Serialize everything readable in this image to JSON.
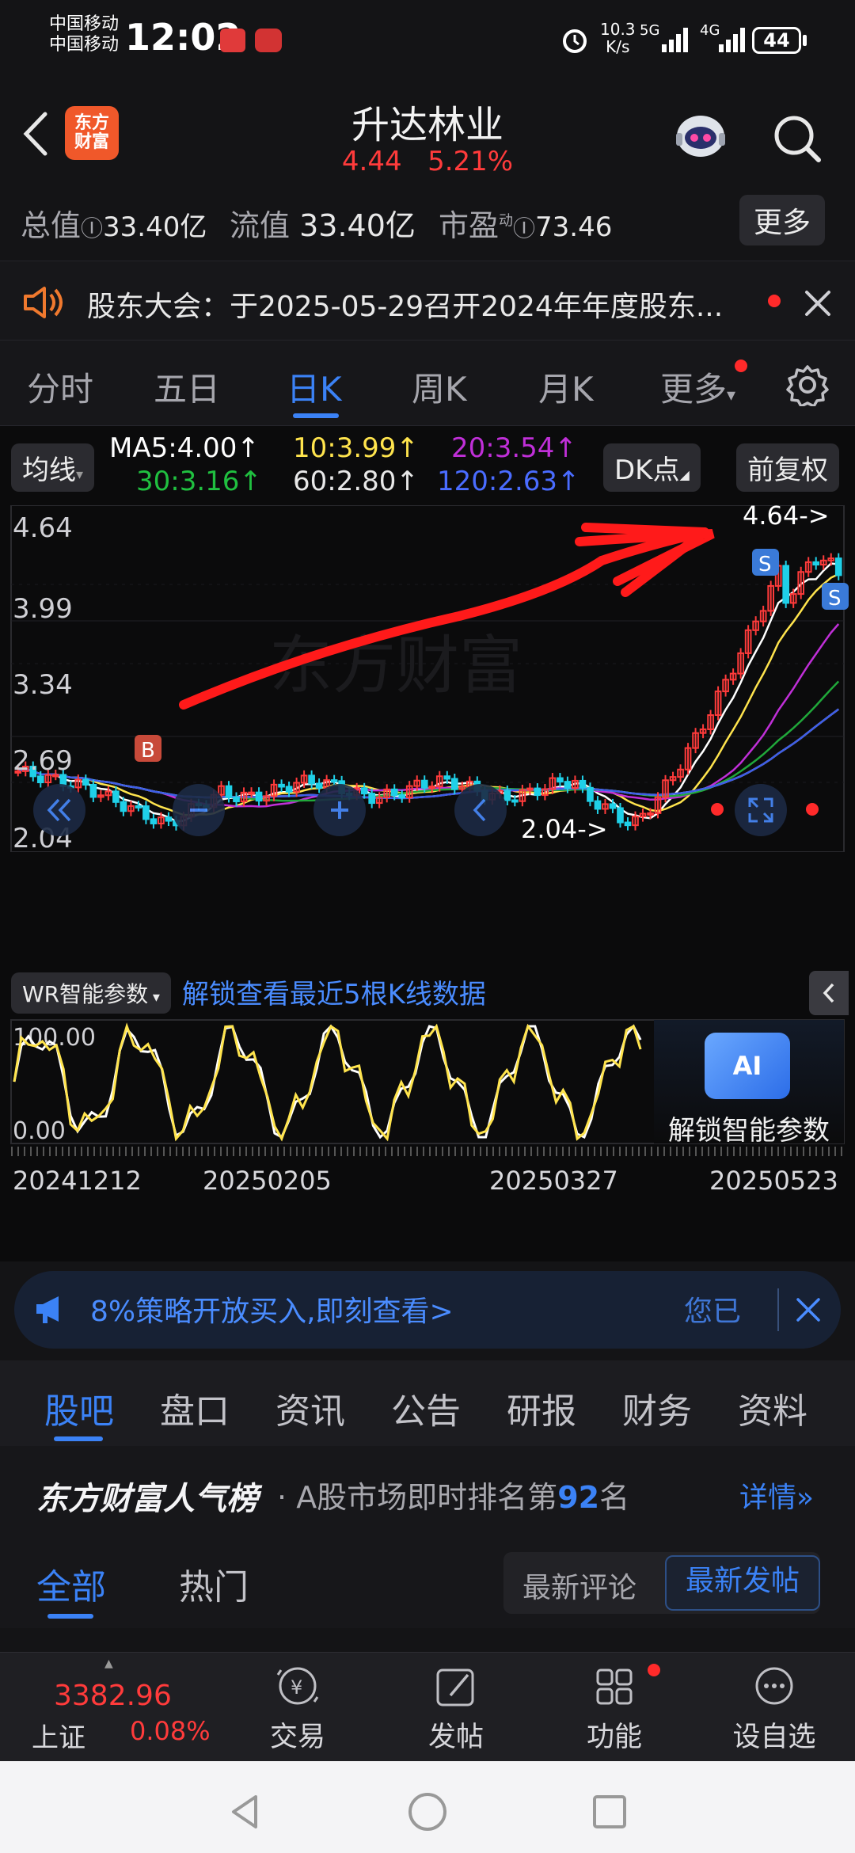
{
  "status": {
    "carrier1": "中国移动",
    "carrier2": "中国移动",
    "time": "12:02",
    "network_speed_value": "10.3",
    "network_speed_unit": "K/s",
    "signal1": "5G",
    "signal2": "4G",
    "battery": "44"
  },
  "header": {
    "title": "升达林业",
    "price": "4.44",
    "change_pct": "5.21%",
    "logo_text_top": "东方",
    "logo_text_bottom": "财富"
  },
  "metrics": {
    "total_value_label": "总值",
    "total_value": "33.40亿",
    "float_value_label": "流值",
    "float_value": "33.40亿",
    "pe_label": "市盈",
    "pe_sup": "动",
    "pe_value": "73.46",
    "more_label": "更多"
  },
  "notice": {
    "text": "股东大会：于2025-05-29召开2024年年度股东..."
  },
  "period_tabs": [
    "分时",
    "五日",
    "日K",
    "周K",
    "月K",
    "更多"
  ],
  "chart_controls": {
    "ma_button": "均线",
    "ma5": "MA5:4.00↑",
    "ma10": "10:3.99↑",
    "ma20": "20:3.54↑",
    "ma30": "30:3.16↑",
    "ma60": "60:2.80↑",
    "ma120": "120:2.63↑",
    "dk_button": "DK点",
    "adjust_button": "前复权"
  },
  "chart_labels": {
    "y_axis": [
      "4.64",
      "3.99",
      "3.34",
      "2.69",
      "2.04"
    ],
    "high_marker": "4.64->",
    "low_marker": "2.04->",
    "buy_marker": "B",
    "sell_marker": "S",
    "watermark": "东方财富"
  },
  "indicator": {
    "name_button": "WR智能参数",
    "unlock_text": "解锁查看最近5根K线数据",
    "y_top": "100.00",
    "y_bottom": "0.00",
    "ai_badge": "AI",
    "ai_unlock": "解锁智能参数"
  },
  "x_axis": [
    "20241212",
    "20250205",
    "20250327",
    "20250523"
  ],
  "colors": {
    "up": "#ff3b3b",
    "down": "#1fd0e8",
    "ma5": "#ffffff",
    "ma10": "#ffe44d",
    "ma20": "#c02fd8",
    "ma30": "#20a83a",
    "ma60": "#e8e8e8",
    "ma120": "#3d5de8",
    "accent": "#3b82f6",
    "red_price": "#ff3b3b"
  },
  "promo": {
    "text": "8%策略开放买入,即刻查看>",
    "tail": "您已"
  },
  "content_tabs": [
    "股吧",
    "盘口",
    "资讯",
    "公告",
    "研报",
    "财务",
    "资料"
  ],
  "rank": {
    "brand": "东方财富人气榜",
    "separator": "·",
    "prefix": "A股市场即时排名第",
    "number": "92",
    "suffix": "名",
    "link": "详情"
  },
  "subtabs": {
    "all": "全部",
    "hot": "热门",
    "latest_comment": "最新评论",
    "latest_post": "最新发帖"
  },
  "bottom_nav": {
    "index_value": "3382.96",
    "index_name": "上证",
    "index_change": "0.08%",
    "trade": "交易",
    "post": "发帖",
    "function": "功能",
    "watchlist": "设自选"
  }
}
